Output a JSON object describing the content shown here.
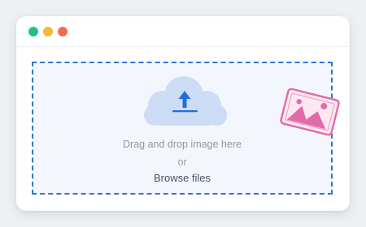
{
  "window": {
    "controls": [
      "close-control",
      "minimize-control",
      "maximize-control"
    ]
  },
  "dropzone": {
    "drop_text": "Drag and drop image here",
    "or_text": "or",
    "browse_label": "Browse files"
  },
  "icons": {
    "upload": "cloud-upload-icon",
    "image": "image-photo-icon"
  },
  "colors": {
    "accent": "#2f74d6",
    "dropzone_background": "#f3f6fd",
    "cloud": "#cddcf5",
    "upload_arrow": "#1e6ee0",
    "photo_card": "#e26ba7",
    "dot_green": "#22c08a",
    "dot_yellow": "#f6b73c",
    "dot_orange": "#f26d4f"
  }
}
